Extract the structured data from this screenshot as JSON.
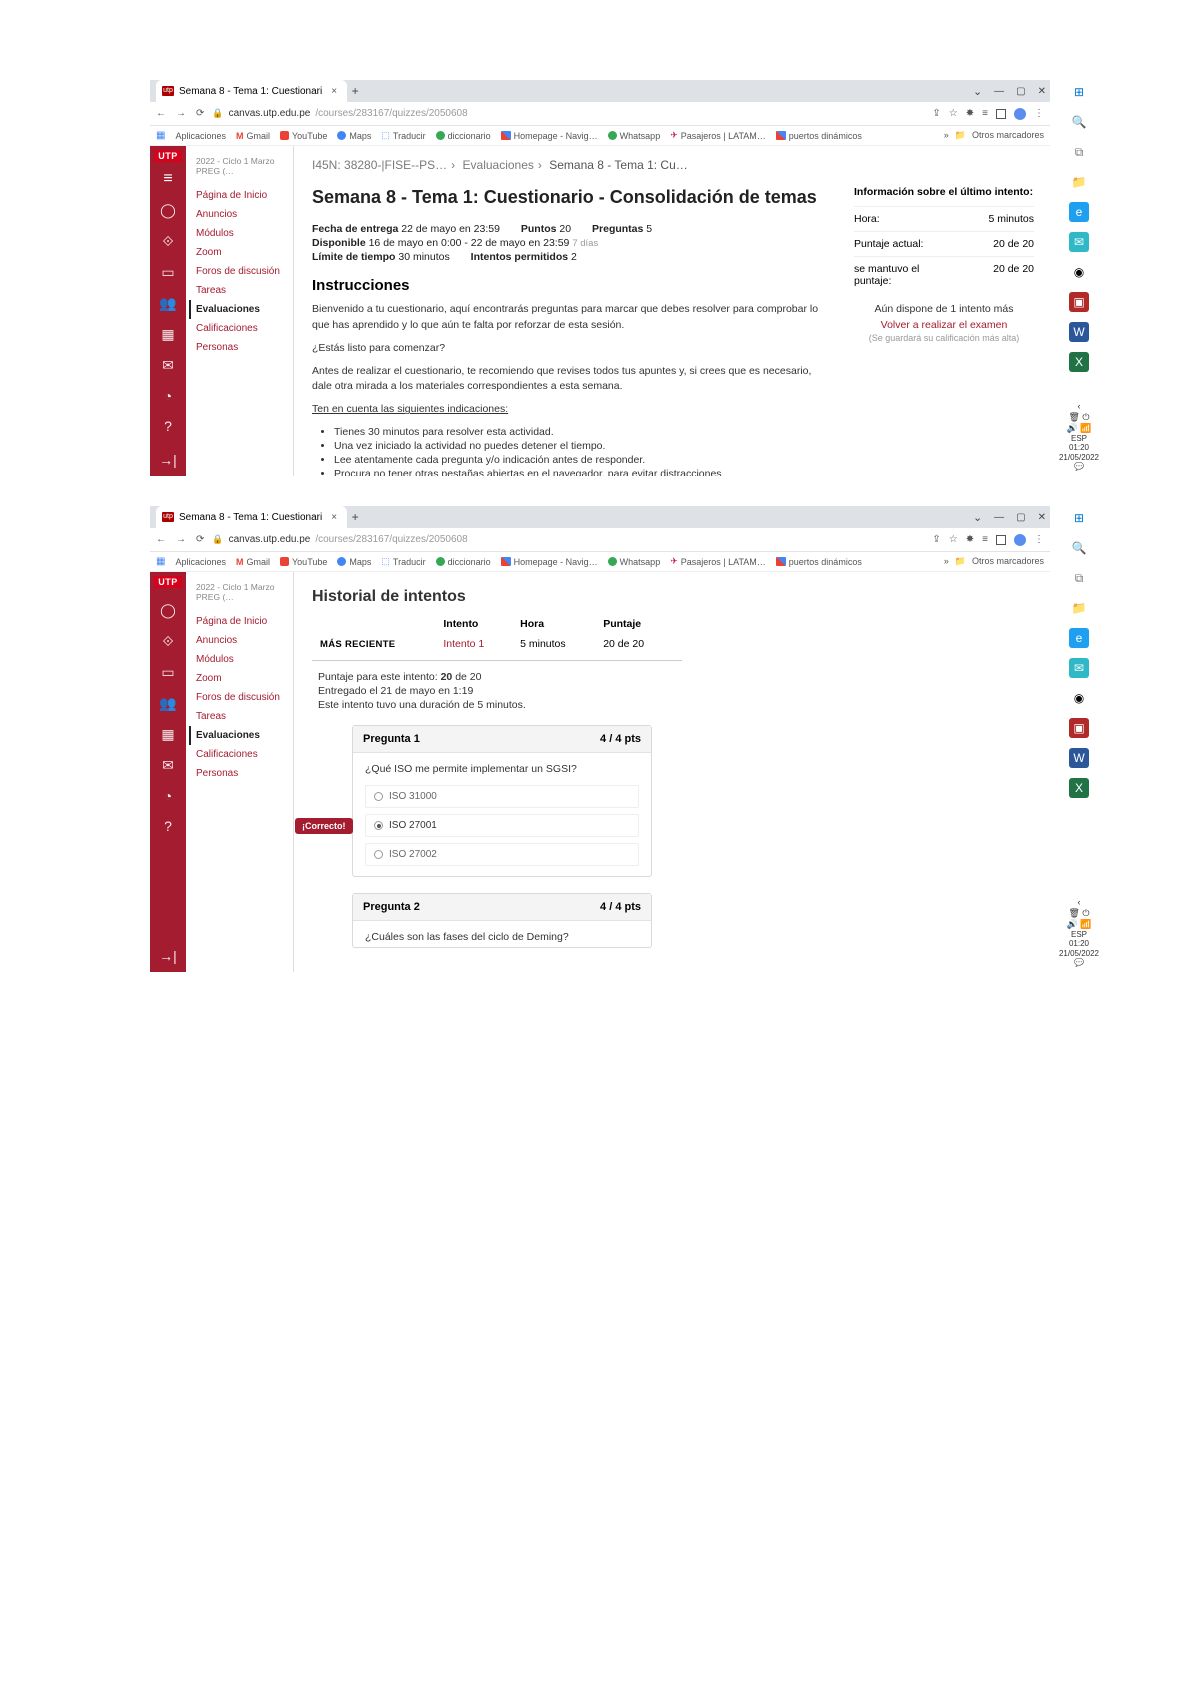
{
  "tab_title": "Semana 8 - Tema 1: Cuestionari",
  "url_host": "canvas.utp.edu.pe",
  "url_path": "/courses/283167/quizzes/2050608",
  "bookmarks": {
    "apps": "Aplicaciones",
    "items": [
      "Gmail",
      "YouTube",
      "Maps",
      "Traducir",
      "diccionario",
      "Homepage - Navig…",
      "Whatsapp",
      "Pasajeros | LATAM…",
      "puertos dinámicos"
    ],
    "other": "Otros marcadores"
  },
  "rail_logo": "UTP",
  "course_term": "2022 - Ciclo 1 Marzo PREG (…",
  "nav_items": [
    "Página de Inicio",
    "Anuncios",
    "Módulos",
    "Zoom",
    "Foros de discusión",
    "Tareas",
    "Evaluaciones",
    "Calificaciones",
    "Personas"
  ],
  "nav_active": "Evaluaciones",
  "breadcrumb": {
    "a": "I45N: 38280-|FISE--PS…",
    "b": "Evaluaciones",
    "c": "Semana 8 - Tema 1: Cu…"
  },
  "s1": {
    "title": "Semana 8 - Tema 1: Cuestionario - Consolidación de temas",
    "due_lbl": "Fecha de entrega",
    "due_val": "22 de mayo en 23:59",
    "pts_lbl": "Puntos",
    "pts_val": "20",
    "q_lbl": "Preguntas",
    "q_val": "5",
    "avail_lbl": "Disponible",
    "avail_val": "16 de mayo en 0:00 - 22 de mayo en 23:59",
    "avail_days": "7 días",
    "limit_lbl": "Límite de tiempo",
    "limit_val": "30 minutos",
    "att_lbl": "Intentos permitidos",
    "att_val": "2",
    "instr_h": "Instrucciones",
    "p1": "Bienvenido a tu cuestionario, aquí encontrarás preguntas para marcar que debes resolver para comprobar lo que has aprendido y lo que aún te falta por reforzar de esta sesión.",
    "p2": "¿Estás listo para comenzar?",
    "p3": "Antes de realizar el cuestionario, te recomiendo que revises todos tus apuntes y, si crees que es necesario, dale otra mirada a los materiales correspondientes a esta semana.",
    "p4": "Ten en cuenta las siguientes indicaciones:",
    "b1": "Tienes 30 minutos para resolver esta actividad.",
    "b2": "Una vez iniciado la actividad no puedes detener el tiempo.",
    "b3": "Lee atentamente cada pregunta y/o indicación antes de responder.",
    "b4": "Procura no tener otras pestañas abiertas en el navegador, para evitar distracciones.",
    "side_h": "Información sobre el último intento:",
    "hora_lbl": "Hora:",
    "hora_val": "5 minutos",
    "punt_lbl": "Puntaje actual:",
    "punt_val": "20 de 20",
    "kept_lbl": "se mantuvo el puntaje:",
    "kept_val": "20 de 20",
    "remain": "Aún dispone de 1 intento más",
    "retake": "Volver a realizar el examen",
    "savenote": "(Se guardará su calificación más alta)"
  },
  "s2": {
    "hist_h": "Historial de intentos",
    "col_a": "Intento",
    "col_b": "Hora",
    "col_c": "Puntaje",
    "row_lbl": "MÁS RECIENTE",
    "row_a": "Intento 1",
    "row_b": "5 minutos",
    "row_c": "20 de 20",
    "score_line_a": "Puntaje para este intento:",
    "score_line_b": "20",
    "score_line_c": "de 20",
    "sub_line": "Entregado el 21 de mayo en 1:19",
    "dur_line": "Este intento tuvo una duración de 5 minutos.",
    "q1_title": "Pregunta 1",
    "q1_pts": "4 / 4 pts",
    "q1_text": "¿Qué ISO me permite implementar un SGSI?",
    "q1_o1": "ISO 31000",
    "q1_o2": "ISO 27001",
    "q1_o3": "ISO 27002",
    "correct": "¡Correcto!",
    "q2_title": "Pregunta 2",
    "q2_pts": "4 / 4 pts",
    "q2_text": "¿Cuáles son las fases del ciclo de Deming?"
  },
  "os": {
    "esp": "ESP",
    "time": "01:20",
    "date": "21/05/2022"
  }
}
